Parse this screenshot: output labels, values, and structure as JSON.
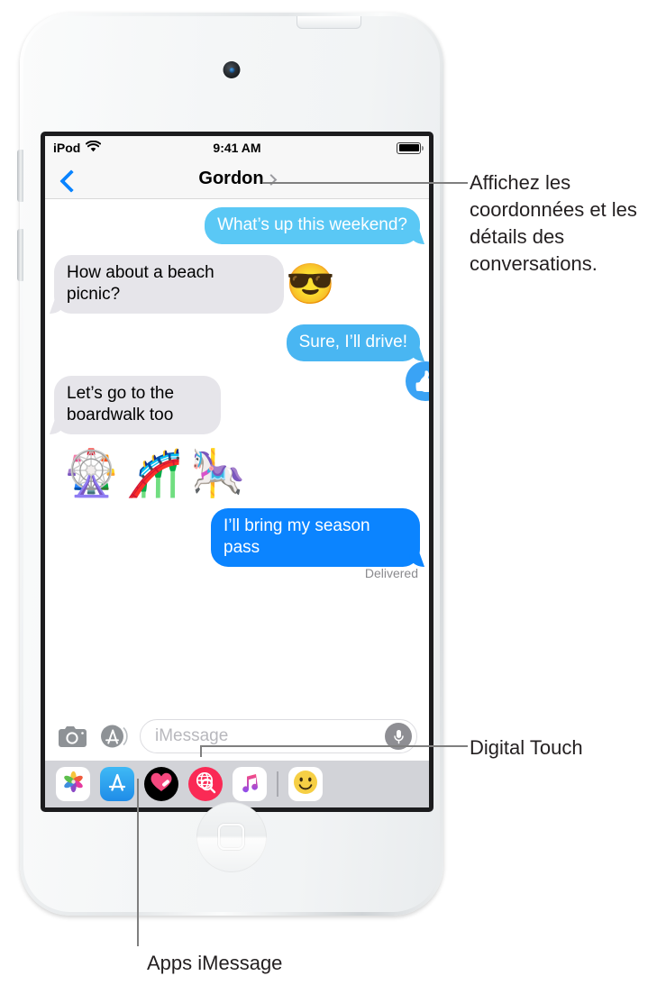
{
  "device": {
    "name": "ipod-touch",
    "camera_label": "front-camera",
    "home_button_label": "home-button"
  },
  "status_bar": {
    "carrier": "iPod",
    "wifi_icon": "wifi-icon",
    "time": "9:41 AM",
    "battery_icon": "battery-full-icon"
  },
  "nav_bar": {
    "back_icon": "back-chevron-icon",
    "title": "Gordon",
    "disclosure_icon": "chevron-right-icon"
  },
  "conversation": {
    "messages": [
      {
        "id": "m1",
        "side": "out",
        "text": "What’s up this weekend?",
        "color": "#5ac8f5"
      },
      {
        "id": "m2",
        "side": "in",
        "text": "How about a beach picnic?",
        "trailing_emoji": "😎"
      },
      {
        "id": "m3",
        "side": "out",
        "text": "Sure, I’ll drive!",
        "color": "#49b6f2"
      },
      {
        "id": "m4",
        "side": "in",
        "text": "Let’s go to the boardwalk too",
        "tapback": "👍"
      }
    ],
    "sticker_row": [
      "🎡",
      "🎢",
      "🎠"
    ],
    "last_message": {
      "id": "m5",
      "side": "out",
      "text": "I’ll bring my season pass",
      "color": "#0b84ff"
    },
    "delivery_status": "Delivered"
  },
  "input_bar": {
    "camera_icon": "camera-icon",
    "appstore_icon": "app-store-icon",
    "placeholder": "iMessage",
    "value": "",
    "mic_icon": "microphone-icon"
  },
  "app_drawer": {
    "items": [
      {
        "name": "photos",
        "icon": "photos-icon"
      },
      {
        "name": "app-store",
        "icon": "app-store-icon"
      },
      {
        "name": "digital-touch",
        "icon": "digital-touch-heart-icon"
      },
      {
        "name": "music-search",
        "icon": "music-search-icon"
      },
      {
        "name": "music",
        "icon": "music-note-icon"
      },
      {
        "name": "emoji",
        "icon": "smiley-icon"
      }
    ]
  },
  "callouts": {
    "details": "Affichez les coordonnées et les détails des conversations.",
    "digital_touch": "Digital Touch",
    "imessage_apps": "Apps iMessage"
  },
  "colors": {
    "imessage_blue": "#0b84ff",
    "sms_light_blue": "#5ac8f5",
    "incoming_gray": "#e6e5ea",
    "tapback_blue": "#3aa3f5",
    "drawer_bg": "#d2d3d8",
    "leader_gray": "#7f7f7f"
  }
}
